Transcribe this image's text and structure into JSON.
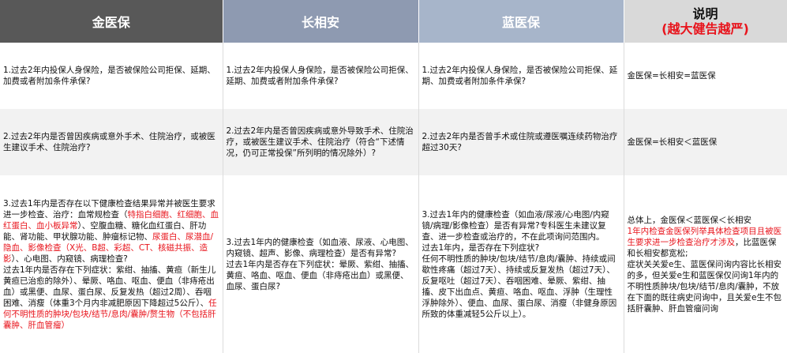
{
  "headers": {
    "col1": "金医保",
    "col2": "长相安",
    "col3": "蓝医保",
    "col4_title": "说明",
    "col4_subtitle": "(越大健告越严)"
  },
  "row1": {
    "col1": "1.过去2年内投保人身保险，是否被保险公司拒保、延期、加费或者附加条件承保?",
    "col2": "1.过去2年内投保人身保险，是否被保险公司拒保、延期、加费或者附加条件承保?",
    "col3": "1.过去2年内投保人身保险，是否被保险公司拒保、延期、加费或者附加条件承保?",
    "col4": "金医保=长相安=蓝医保"
  },
  "row2": {
    "col1": "2.过去2年内是否曾因疾病或意外手术、住院治疗，或被医生建议手术、住院治疗?",
    "col2": "2.过去2年内是否曾因疾病或意外导致手术、住院治疗，或被医生建议手术、住院治疗（符合“下述情况，仍可正常投保”所列明的情况除外）?",
    "col3": "2.过去2年内是否曾手术或住院或遵医嘱连续药物治疗超过30天?",
    "col4": "金医保=长相安＜蓝医保"
  },
  "row3": {
    "col1": {
      "t1": "3.过去1年内是否存在以下健康检查结果异常并被医生要求进一步检查、治疗：血常规检查（",
      "r1": "特指白细胞、红细胞、血红蛋白、血小板异常",
      "t2": "）、空腹血糖、糖化血红蛋白、肝功能、肾功能、甲状腺功能、肿瘤标记物、",
      "r2": "尿蛋白、尿潜血/隐血、影像检查（X光、B超、彩超、CT、核磁共振、造影",
      "t3": "）、心电图、内窥镜、病理检查?",
      "t4": "过去1年内是否存在下列症状：紫绀、抽搐、黄疸（新生儿黄疸已治愈的除外）、晕厥、咯血、呕血、便血（非痔疮出血）或黑便、血尿、蛋白尿、反复发热（超过2周）、吞咽困难、消瘦（体重3个月内非减肥原因下降超过5公斤）、",
      "r3": "任何不明性质的肿块/包块/结节/息肉/囊肿/赘生物（不包括肝囊肿、肝血管瘤）"
    },
    "col2": {
      "p1": "3.过去1年内的健康检查（如血液、尿液、心电图、内窥镜、超声、影像、病理检查）是否有异常?",
      "p2": "过去1年内是否存在下列症状：晕厥、紫绀、抽搐、黄疸、咯血、呕血、便血（非痔疮出血）或黑便、血尿、蛋白尿?"
    },
    "col3": {
      "p1": "3.过去1年内的健康检查（如血液/尿液/心电图/内窥镜/病理/影像检查）是否有异常?专科医生未建议复查、进一步检查或治疗的，不在此项询问范围内。",
      "p2": "过去1年内，是否存在下列症状?",
      "p3": "任何不明性质的肿块/包块/结节/息肉/囊肿、持续或间歇性疼痛（超过7天）、持续或反复发热（超过7天）、反复呕吐（超过7天）、吞咽困难、晕厥、紫绀、抽搐、皮下出血点、黄疸、咯血、呕血、浮肿（生理性浮肿除外）、便血、血尿、蛋白尿、消瘦（非健身原因所致的体重减轻5公斤以上）。"
    },
    "col4": {
      "t1": "总体上，金医保＜蓝医保＜长相安",
      "r1": "1年内检查金医保列举具体检查项目且被医生要求进一步检查治疗才涉及",
      "t2": "，比蓝医保和长相安都宽松;",
      "t3": "症状关关爱e生、蓝医保问询内容比长相安的多，但关爱e生和蓝医保仅问询1年内的不明性质肿块/包块/结节/息肉/囊肿，不放在下面的既往病史问询中，且关爱e生不包括肝囊肿、肝血管瘤问询"
    }
  }
}
